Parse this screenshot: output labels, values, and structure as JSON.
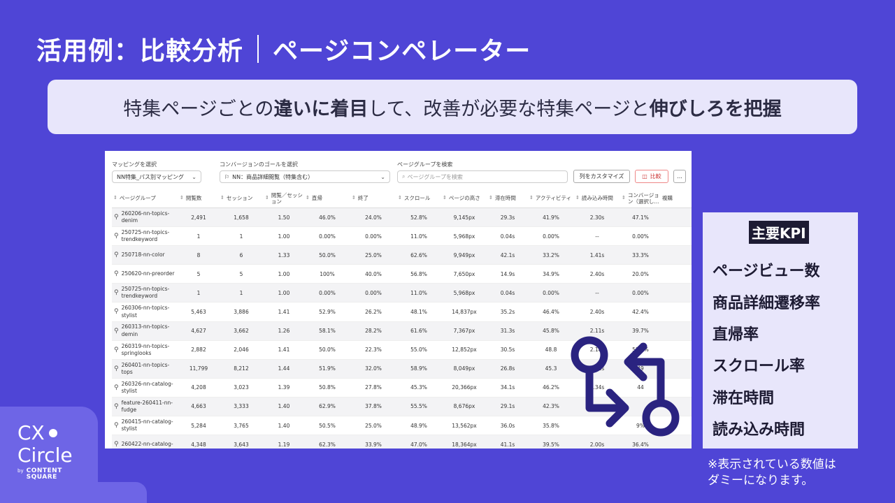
{
  "title": {
    "left": "活用例：比較分析",
    "right": "ページコンペレーター"
  },
  "banner": {
    "p1": "特集ページごとの",
    "b1": "違いに着目",
    "p2": "して、改善が必要な特集ページと",
    "b2": "伸びしろを把握"
  },
  "controls": {
    "mapping_label": "マッピングを選択",
    "mapping_value": "NN特集_パス別マッピング",
    "goal_label": "コンバージョンのゴールを選択",
    "goal_value": "NN：商品詳細閲覧（特集含む）",
    "search_label": "ページグループを検索",
    "search_placeholder": "ページグループを検索",
    "customize_button": "列をカスタマイズ",
    "compare_button": "比較",
    "more_button": "..."
  },
  "table": {
    "headers": [
      "ページグループ",
      "閲覧数",
      "セッション",
      "閲覧／セッション",
      "直帰",
      "終了",
      "スクロール",
      "ページの高さ",
      "滞在時間",
      "アクティビティ",
      "読み込み時間",
      "コンバージョン（選択し...",
      "複購"
    ],
    "rows": [
      {
        "name": "260206-nn-topics-denim",
        "c": [
          "2,491",
          "1,658",
          "1.50",
          "46.0%",
          "24.0%",
          "52.8%",
          "9,145px",
          "29.3s",
          "41.9%",
          "2.30s",
          "47.1%"
        ]
      },
      {
        "name": "250725-nn-topics-trendkeyword",
        "c": [
          "1",
          "1",
          "1.00",
          "0.00%",
          "0.00%",
          "11.0%",
          "5,968px",
          "0.04s",
          "0.00%",
          "--",
          "0.00%"
        ]
      },
      {
        "name": "250718-nn-color",
        "c": [
          "8",
          "6",
          "1.33",
          "50.0%",
          "25.0%",
          "62.6%",
          "9,949px",
          "42.1s",
          "33.2%",
          "1.41s",
          "33.3%"
        ]
      },
      {
        "name": "250620-nn-preorder",
        "c": [
          "5",
          "5",
          "1.00",
          "100%",
          "40.0%",
          "56.8%",
          "7,650px",
          "14.9s",
          "34.9%",
          "2.40s",
          "20.0%"
        ]
      },
      {
        "name": "250725-nn-topics-trendkeyword",
        "c": [
          "1",
          "1",
          "1.00",
          "0.00%",
          "0.00%",
          "11.0%",
          "5,968px",
          "0.04s",
          "0.00%",
          "--",
          "0.00%"
        ]
      },
      {
        "name": "260306-nn-topics-stylist",
        "c": [
          "5,463",
          "3,886",
          "1.41",
          "52.9%",
          "26.2%",
          "48.1%",
          "14,837px",
          "35.2s",
          "46.4%",
          "2.40s",
          "42.4%"
        ]
      },
      {
        "name": "260313-nn-topics-demin",
        "c": [
          "4,627",
          "3,662",
          "1.26",
          "58.1%",
          "28.2%",
          "61.6%",
          "7,367px",
          "31.3s",
          "45.8%",
          "2.11s",
          "39.7%"
        ]
      },
      {
        "name": "260319-nn-topics-springlooks",
        "c": [
          "2,882",
          "2,046",
          "1.41",
          "50.0%",
          "22.3%",
          "55.0%",
          "12,852px",
          "30.5s",
          "48.8",
          "2.18s",
          "53.3%"
        ]
      },
      {
        "name": "260401-nn-topics-tops",
        "c": [
          "11,799",
          "8,212",
          "1.44",
          "51.9%",
          "32.0%",
          "58.9%",
          "8,049px",
          "26.8s",
          "45.3",
          "2.11s",
          "49"
        ]
      },
      {
        "name": "260326-nn-catalog-stylist",
        "c": [
          "4,208",
          "3,023",
          "1.39",
          "50.8%",
          "27.8%",
          "45.3%",
          "20,366px",
          "34.1s",
          "46.2%",
          "2.34s",
          "44"
        ]
      },
      {
        "name": "feature-260411-nn-fudge",
        "c": [
          "4,663",
          "3,333",
          "1.40",
          "62.9%",
          "37.8%",
          "55.5%",
          "8,676px",
          "29.1s",
          "42.3%",
          "",
          ""
        ]
      },
      {
        "name": "260415-nn-catalog-stylist",
        "c": [
          "5,284",
          "3,765",
          "1.40",
          "50.5%",
          "25.0%",
          "48.9%",
          "13,562px",
          "36.0s",
          "35.8%",
          "",
          "9%"
        ]
      },
      {
        "name": "260422-nn-catalog-",
        "c": [
          "4,348",
          "3,643",
          "1.19",
          "62.3%",
          "33.9%",
          "47.0%",
          "18,364px",
          "41.1s",
          "39.5%",
          "2.00s",
          "36.4%"
        ]
      }
    ]
  },
  "kpi": {
    "title": "主要KPI",
    "items": [
      "ページビュー数",
      "商品詳細遷移率",
      "直帰率",
      "スクロール率",
      "滞在時間",
      "読み込み時間"
    ]
  },
  "note": {
    "line1": "※表示されている数値は",
    "line2": "ダミーになります。"
  },
  "logo": {
    "line1": "CX",
    "line2": "Circle",
    "by": "by",
    "brand1": "CONTENT",
    "brand2": "SQUARE"
  },
  "colors": {
    "background": "#4f45d6",
    "banner": "#e8e6fb",
    "icon": "#2a2380"
  }
}
